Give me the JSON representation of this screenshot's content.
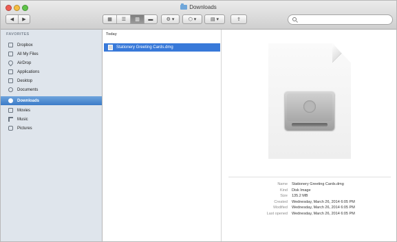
{
  "window": {
    "title": "Downloads"
  },
  "toolbar": {
    "back_icon": "chevron-left-icon",
    "forward_icon": "chevron-right-icon",
    "view_modes": [
      "icon-view-icon",
      "list-view-icon",
      "column-view-icon",
      "coverflow-view-icon"
    ],
    "selected_view": "column-view-icon",
    "search": {
      "value": "",
      "placeholder": ""
    }
  },
  "sidebar": {
    "section_title": "FAVORITES",
    "items": [
      {
        "label": "Dropbox",
        "icon": "box-icon"
      },
      {
        "label": "All My Files",
        "icon": "files-icon"
      },
      {
        "label": "AirDrop",
        "icon": "airdrop-icon"
      },
      {
        "label": "Applications",
        "icon": "applications-icon"
      },
      {
        "label": "Desktop",
        "icon": "desktop-icon"
      },
      {
        "label": "Documents",
        "icon": "documents-icon"
      },
      {
        "label": "Downloads",
        "icon": "downloads-icon"
      },
      {
        "label": "Movies",
        "icon": "movies-icon"
      },
      {
        "label": "Music",
        "icon": "music-icon"
      },
      {
        "label": "Pictures",
        "icon": "pictures-icon"
      }
    ],
    "selected_index": 6
  },
  "column": {
    "header": "Today",
    "files": [
      {
        "name": "Stationery Greeting Cards.dmg"
      }
    ]
  },
  "preview": {
    "icon": "disk-image-icon",
    "info": [
      {
        "key": "Name",
        "value": "Stationery Greeting Cards.dmg"
      },
      {
        "key": "Kind",
        "value": "Disk Image"
      },
      {
        "key": "Size",
        "value": "135.2 MB"
      },
      {
        "key": "Created",
        "value": "Wednesday, March 26, 2014 6:05 PM"
      },
      {
        "key": "Modified",
        "value": "Wednesday, March 26, 2014 6:05 PM"
      },
      {
        "key": "Last opened",
        "value": "Wednesday, March 26, 2014 6:05 PM"
      }
    ]
  }
}
